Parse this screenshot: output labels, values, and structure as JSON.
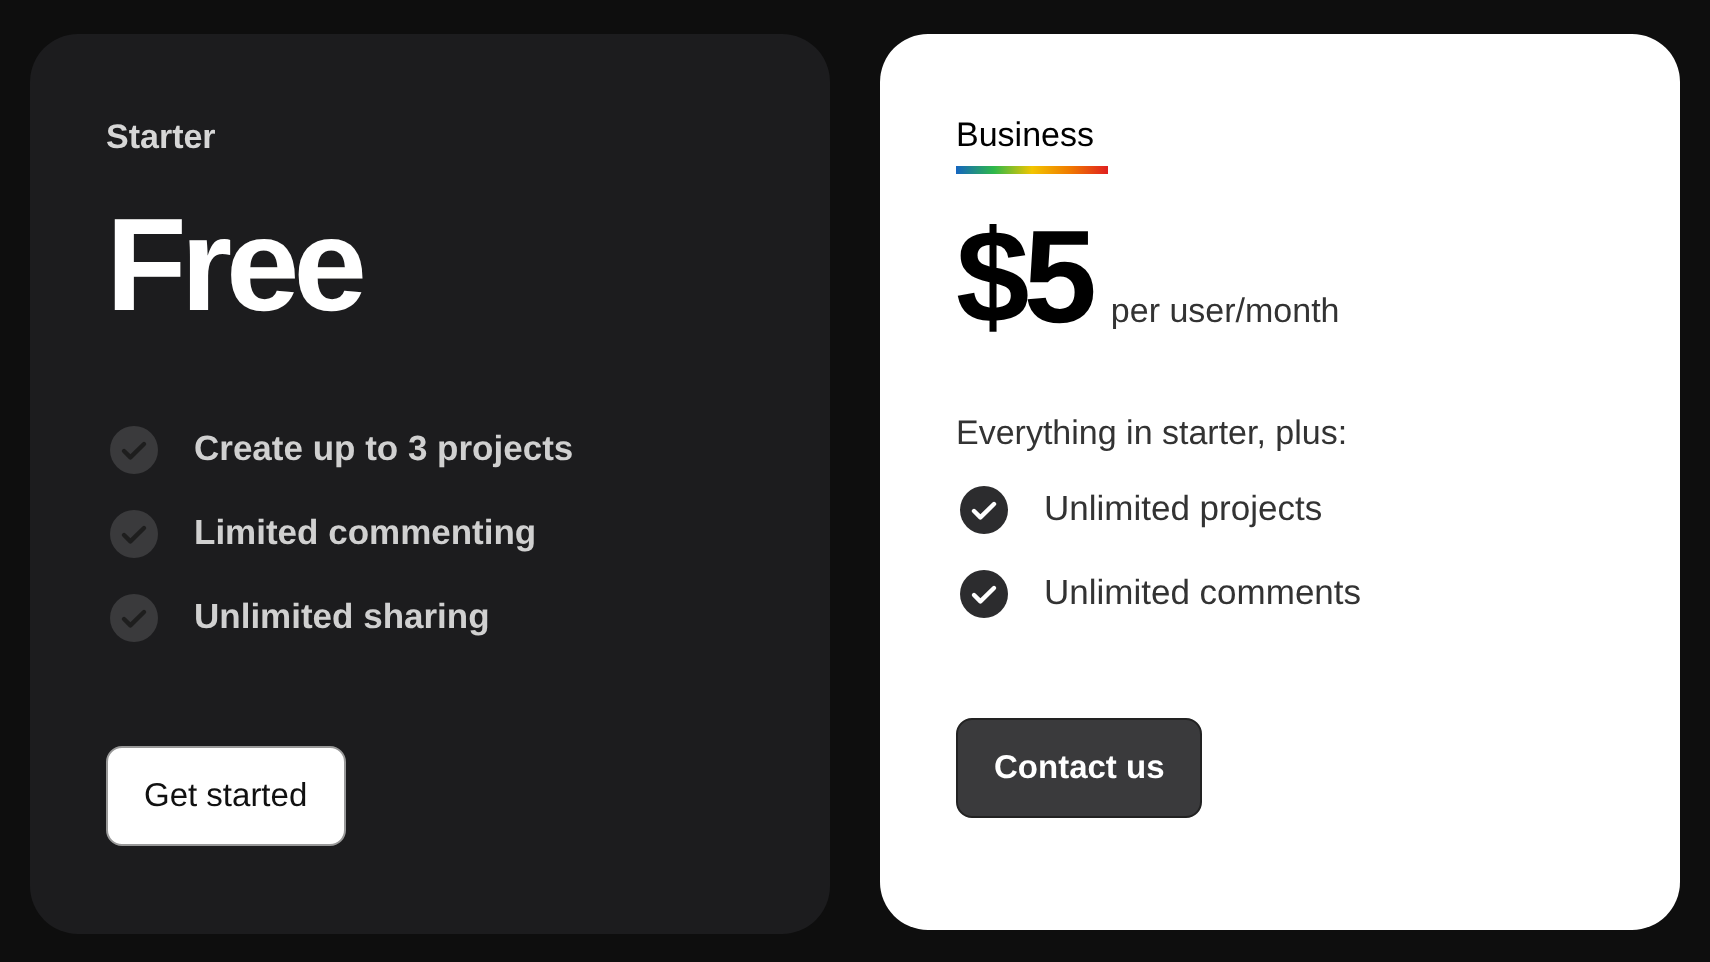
{
  "plans": [
    {
      "kind": "dark",
      "name": "Starter",
      "price": "Free",
      "features": [
        "Create up to 3 projects",
        "Limited commenting",
        "Unlimited sharing"
      ],
      "button": "Get started"
    },
    {
      "kind": "light",
      "name": "Business",
      "price": "$5",
      "price_note": "per user/month",
      "intro": "Everything in starter, plus:",
      "features": [
        "Unlimited projects",
        "Unlimited comments"
      ],
      "button": "Contact us"
    }
  ]
}
